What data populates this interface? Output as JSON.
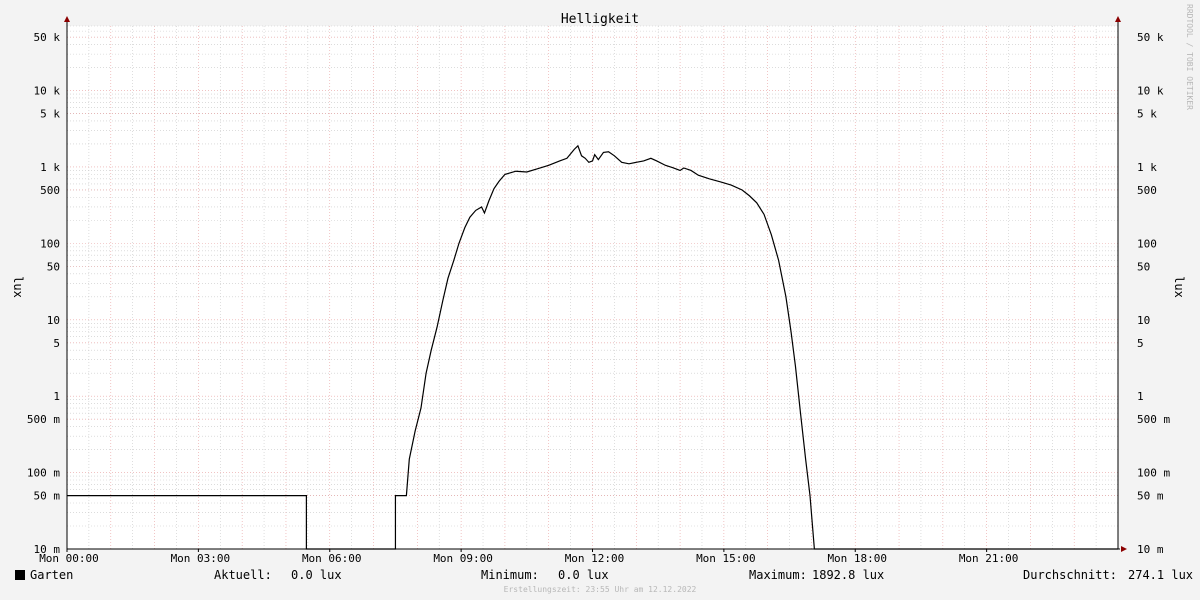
{
  "chart_data": {
    "type": "line",
    "title": "Helligkeit",
    "ylabel": "lux",
    "ylabel_right": "lux",
    "watermark": "RRDTOOL / TOBI OETIKER",
    "y_scale": "log",
    "ylim": [
      0.01,
      70000
    ],
    "xlim": [
      "00:00",
      "24:00"
    ],
    "y_ticks": [
      {
        "v": 0.01,
        "label": "10 m"
      },
      {
        "v": 0.05,
        "label": "50 m"
      },
      {
        "v": 0.1,
        "label": "100 m"
      },
      {
        "v": 0.5,
        "label": "500 m"
      },
      {
        "v": 1,
        "label": "1"
      },
      {
        "v": 5,
        "label": "5"
      },
      {
        "v": 10,
        "label": "10"
      },
      {
        "v": 50,
        "label": "50"
      },
      {
        "v": 100,
        "label": "100"
      },
      {
        "v": 500,
        "label": "500"
      },
      {
        "v": 1000,
        "label": "1 k"
      },
      {
        "v": 5000,
        "label": "5 k"
      },
      {
        "v": 10000,
        "label": "10 k"
      },
      {
        "v": 50000,
        "label": "50 k"
      }
    ],
    "x_ticks": [
      {
        "t": "00:00",
        "label": "Mon 00:00"
      },
      {
        "t": "03:00",
        "label": "Mon 03:00"
      },
      {
        "t": "06:00",
        "label": "Mon 06:00"
      },
      {
        "t": "09:00",
        "label": "Mon 09:00"
      },
      {
        "t": "12:00",
        "label": "Mon 12:00"
      },
      {
        "t": "15:00",
        "label": "Mon 15:00"
      },
      {
        "t": "18:00",
        "label": "Mon 18:00"
      },
      {
        "t": "21:00",
        "label": "Mon 21:00"
      }
    ],
    "grid": true,
    "colors": {
      "line": "#000000",
      "major_grid": "#e8a0a0",
      "minor_grid": "#c8c8c8",
      "axis": "#000000",
      "arrow": "#8b0000"
    },
    "series": [
      {
        "name": "Garten",
        "points": [
          [
            "00:00",
            0.05
          ],
          [
            "05:28",
            0.05
          ],
          [
            "05:28",
            0.01
          ],
          [
            "07:30",
            0.01
          ],
          [
            "07:30",
            0.05
          ],
          [
            "07:45",
            0.05
          ],
          [
            "07:49",
            0.15
          ],
          [
            "07:57",
            0.35
          ],
          [
            "08:05",
            0.7
          ],
          [
            "08:12",
            2
          ],
          [
            "08:19",
            4
          ],
          [
            "08:27",
            8
          ],
          [
            "08:35",
            18
          ],
          [
            "08:42",
            35
          ],
          [
            "08:50",
            60
          ],
          [
            "08:57",
            100
          ],
          [
            "09:05",
            160
          ],
          [
            "09:12",
            220
          ],
          [
            "09:20",
            270
          ],
          [
            "09:28",
            300
          ],
          [
            "09:32",
            250
          ],
          [
            "09:38",
            360
          ],
          [
            "09:45",
            520
          ],
          [
            "09:52",
            650
          ],
          [
            "10:00",
            800
          ],
          [
            "10:15",
            880
          ],
          [
            "10:30",
            860
          ],
          [
            "10:45",
            950
          ],
          [
            "11:00",
            1050
          ],
          [
            "11:15",
            1200
          ],
          [
            "11:25",
            1300
          ],
          [
            "11:35",
            1700
          ],
          [
            "11:40",
            1890
          ],
          [
            "11:45",
            1400
          ],
          [
            "11:50",
            1300
          ],
          [
            "11:55",
            1150
          ],
          [
            "12:00",
            1200
          ],
          [
            "12:03",
            1450
          ],
          [
            "12:08",
            1250
          ],
          [
            "12:15",
            1550
          ],
          [
            "12:22",
            1580
          ],
          [
            "12:30",
            1400
          ],
          [
            "12:40",
            1150
          ],
          [
            "12:50",
            1100
          ],
          [
            "13:00",
            1150
          ],
          [
            "13:10",
            1200
          ],
          [
            "13:20",
            1300
          ],
          [
            "13:28",
            1200
          ],
          [
            "13:40",
            1050
          ],
          [
            "13:50",
            980
          ],
          [
            "14:00",
            900
          ],
          [
            "14:05",
            970
          ],
          [
            "14:15",
            900
          ],
          [
            "14:25",
            780
          ],
          [
            "14:40",
            700
          ],
          [
            "14:55",
            640
          ],
          [
            "15:10",
            580
          ],
          [
            "15:25",
            500
          ],
          [
            "15:35",
            420
          ],
          [
            "15:45",
            340
          ],
          [
            "15:55",
            240
          ],
          [
            "16:05",
            130
          ],
          [
            "16:15",
            60
          ],
          [
            "16:25",
            20
          ],
          [
            "16:32",
            7
          ],
          [
            "16:38",
            2.5
          ],
          [
            "16:45",
            0.6
          ],
          [
            "16:52",
            0.15
          ],
          [
            "16:58",
            0.05
          ],
          [
            "17:04",
            0.01
          ],
          [
            "24:00",
            0.01
          ]
        ]
      }
    ]
  },
  "legend": {
    "series_name": "Garten",
    "current_label": "Aktuell:",
    "current_value": "0.0 lux",
    "min_label": "Minimum:",
    "min_value": "0.0 lux",
    "max_label": "Maximum:",
    "max_value": "1892.8 lux",
    "avg_label": "Durchschnitt:",
    "avg_value": "274.1 lux"
  },
  "footer": "Erstellungszeit: 23:55 Uhr am 12.12.2022"
}
